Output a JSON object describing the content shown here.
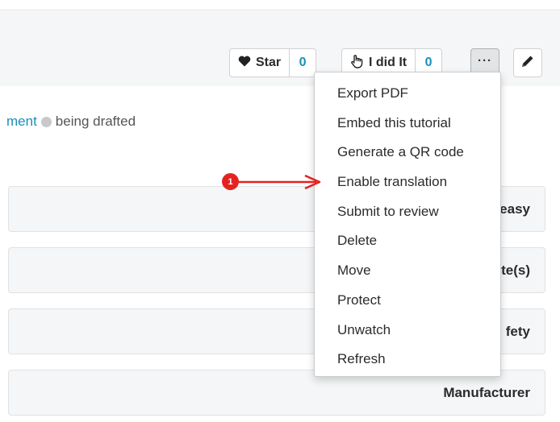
{
  "toolbar": {
    "star_label": "Star",
    "star_count": "0",
    "did_it_label": "I did It",
    "did_it_count": "0",
    "more_label": "···"
  },
  "status": {
    "link_text": "ment",
    "state_text": "being drafted"
  },
  "rows": [
    {
      "label": "easy"
    },
    {
      "label": "te(s)"
    },
    {
      "label": "fety"
    },
    {
      "label": "Manufacturer"
    }
  ],
  "menu": {
    "items": [
      "Export PDF",
      "Embed this tutorial",
      "Generate a QR code",
      "Enable translation",
      "Submit to review",
      "Delete",
      "Move",
      "Protect",
      "Unwatch",
      "Refresh"
    ]
  },
  "callout": {
    "number": "1"
  },
  "colors": {
    "accent": "#1a8fb8",
    "callout": "#e5221f",
    "panel": "#f5f6f7"
  },
  "icons": {
    "star": "heart-icon",
    "did_it": "hand-icon",
    "edit": "pencil-icon"
  }
}
